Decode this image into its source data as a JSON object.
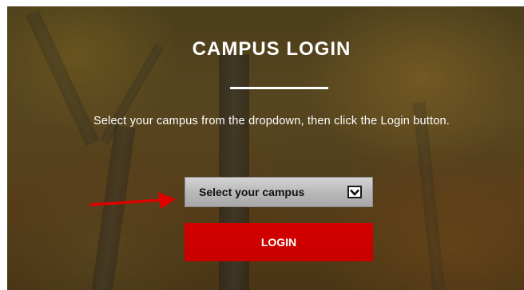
{
  "login": {
    "title": "CAMPUS LOGIN",
    "instructions": "Select your campus from the dropdown, then click the Login button.",
    "campus_select": {
      "selected": "Select your campus"
    },
    "login_button_label": "LOGIN"
  },
  "icons": {
    "dropdown": "chevron-down-icon",
    "annotation": "arrow-right-icon"
  },
  "colors": {
    "login_button": "#cc0000",
    "annotation_arrow": "#e00000",
    "text": "#ffffff"
  }
}
